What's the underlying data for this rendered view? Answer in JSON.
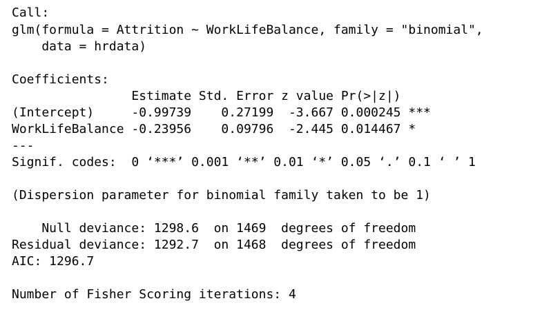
{
  "output": {
    "lines": [
      "Call:",
      "glm(formula = Attrition ~ WorkLifeBalance, family = \"binomial\",",
      "    data = hrdata)",
      "",
      "Coefficients:",
      "                Estimate Std. Error z value Pr(>|z|)    ",
      "(Intercept)     -0.99739    0.27199  -3.667 0.000245 ***",
      "WorkLifeBalance -0.23956    0.09796  -2.445 0.014467 *  ",
      "---",
      "Signif. codes:  0 ‘***’ 0.001 ‘**’ 0.01 ‘*’ 0.05 ‘.’ 0.1 ‘ ’ 1",
      "",
      "(Dispersion parameter for binomial family taken to be 1)",
      "",
      "    Null deviance: 1298.6  on 1469  degrees of freedom",
      "Residual deviance: 1292.7  on 1468  degrees of freedom",
      "AIC: 1296.7",
      "",
      "Number of Fisher Scoring iterations: 4"
    ]
  },
  "colors": {
    "background": "#ffffff",
    "text": "#000000"
  }
}
